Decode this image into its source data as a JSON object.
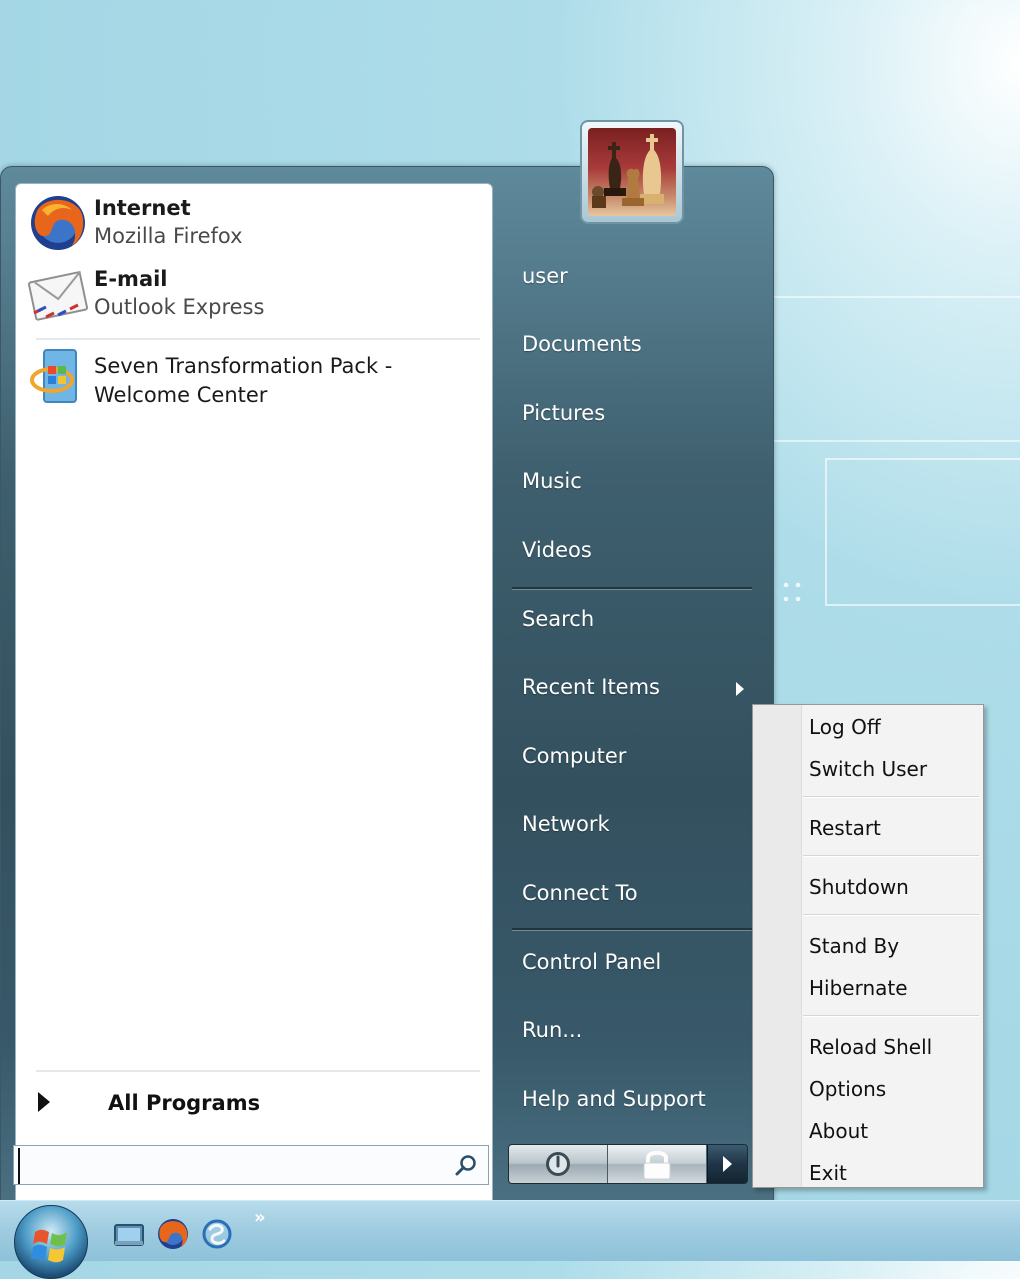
{
  "start_menu": {
    "pinned": [
      {
        "title": "Internet",
        "subtitle": "Mozilla Firefox",
        "icon": "firefox-icon"
      },
      {
        "title": "E-mail",
        "subtitle": "Outlook Express",
        "icon": "envelope-icon"
      }
    ],
    "recent": [
      {
        "line1": "Seven Transformation Pack -",
        "line2": "Welcome Center",
        "icon": "windows-logo-icon"
      }
    ],
    "all_programs_label": "All Programs",
    "search": {
      "value": "",
      "placeholder": ""
    },
    "right_items": [
      {
        "label": "user"
      },
      {
        "label": "Documents"
      },
      {
        "label": "Pictures"
      },
      {
        "label": "Music"
      },
      {
        "label": "Videos"
      },
      {
        "label": "Search"
      },
      {
        "label": "Recent Items",
        "has_submenu": true
      },
      {
        "label": "Computer"
      },
      {
        "label": "Network"
      },
      {
        "label": "Connect To"
      },
      {
        "label": "Control Panel"
      },
      {
        "label": "Run..."
      },
      {
        "label": "Help and Support"
      }
    ],
    "power_buttons": [
      "power-icon",
      "lock-icon",
      "arrow-right-icon"
    ]
  },
  "context_menu": {
    "items": [
      {
        "label": "Log Off"
      },
      {
        "label": "Switch User"
      },
      {
        "label": "Restart"
      },
      {
        "label": "Shutdown"
      },
      {
        "label": "Stand By"
      },
      {
        "label": "Hibernate"
      },
      {
        "label": "Reload Shell"
      },
      {
        "label": "Options"
      },
      {
        "label": "About"
      },
      {
        "label": "Exit"
      }
    ]
  },
  "taskbar": {
    "quick_launch": [
      "show-desktop-icon",
      "firefox-icon",
      "switcher-icon"
    ],
    "overflow": "»"
  },
  "colors": {
    "menu_blue_dark": "#33505e",
    "menu_blue_light": "#5f8a9c",
    "desktop": "#a6d8e6"
  }
}
